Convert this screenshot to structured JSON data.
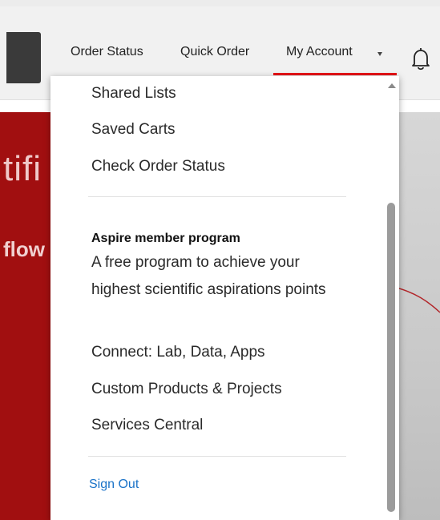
{
  "header": {
    "nav": {
      "order_status": "Order Status",
      "quick_order": "Quick Order",
      "my_account": "My Account"
    }
  },
  "hero": {
    "line1": "tifi",
    "line2": "flow"
  },
  "account_menu": {
    "items_top": [
      "Shared Lists",
      "Saved Carts",
      "Check Order Status"
    ],
    "program": {
      "title": "Aspire member program",
      "description": "A free program to achieve your highest scientific aspirations points"
    },
    "items_bottom": [
      "Connect: Lab, Data, Apps",
      "Custom Products & Projects",
      "Services Central"
    ],
    "sign_out": "Sign Out"
  },
  "colors": {
    "accent_red": "#e71316",
    "link_blue": "#1a73c8",
    "hero_red": "#a10f10"
  },
  "icons": [
    "search-icon",
    "caret-down-icon",
    "bell-icon",
    "scroll-up-icon"
  ]
}
